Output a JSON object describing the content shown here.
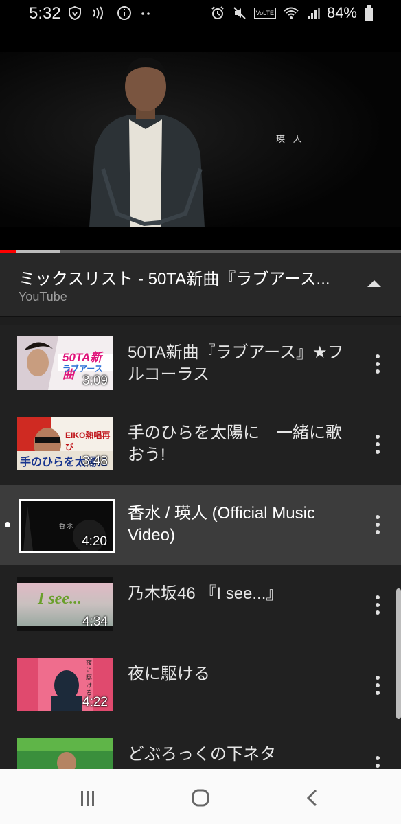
{
  "status_bar": {
    "time": "5:32",
    "battery": "84%",
    "left_icons": [
      "shield-icon",
      "nfc-icon",
      "info-icon",
      "more-dots-icon"
    ],
    "right_icons": [
      "alarm-icon",
      "mute-icon",
      "volte-icon",
      "wifi-icon",
      "signal-icon",
      "battery-icon"
    ],
    "volte_label": "VoLTE"
  },
  "player": {
    "caption": "瑛 人",
    "progress": 0.04,
    "buffer": 0.15
  },
  "playlist": {
    "title": "ミックスリスト - 50TA新曲『ラブアース...",
    "channel": "YouTube"
  },
  "items": [
    {
      "title": "50TA新曲『ラブアース』★フルコーラス",
      "duration": "3:09",
      "active": false
    },
    {
      "title": "手のひらを太陽に　一緒に歌おう!",
      "duration": "3:48",
      "active": false
    },
    {
      "title": "香水  /  瑛人 (Official Music Video)",
      "duration": "4:20",
      "active": true
    },
    {
      "title": "乃木坂46 『I see...』",
      "duration": "4:34",
      "active": false
    },
    {
      "title": "夜に駆ける",
      "duration": "4:22",
      "active": false
    },
    {
      "title": "どぶろっくの下ネタ",
      "duration": "",
      "active": false
    }
  ],
  "thumb_text": {
    "t1_main": "50TA新曲",
    "t1_sub": "ラブアース",
    "t2_main": "EIKO熱唱再び",
    "t2_sub": "手のひらを太陽に",
    "t3_main": "香 水",
    "t4_main": "I see...",
    "t5_main": "夜に駆ける"
  },
  "nav": {
    "icons": [
      "recent-apps-icon",
      "home-icon",
      "back-icon"
    ]
  },
  "colors": {
    "accent": "#ff0000",
    "background": "#212121",
    "active_row": "#3c3c3c"
  }
}
